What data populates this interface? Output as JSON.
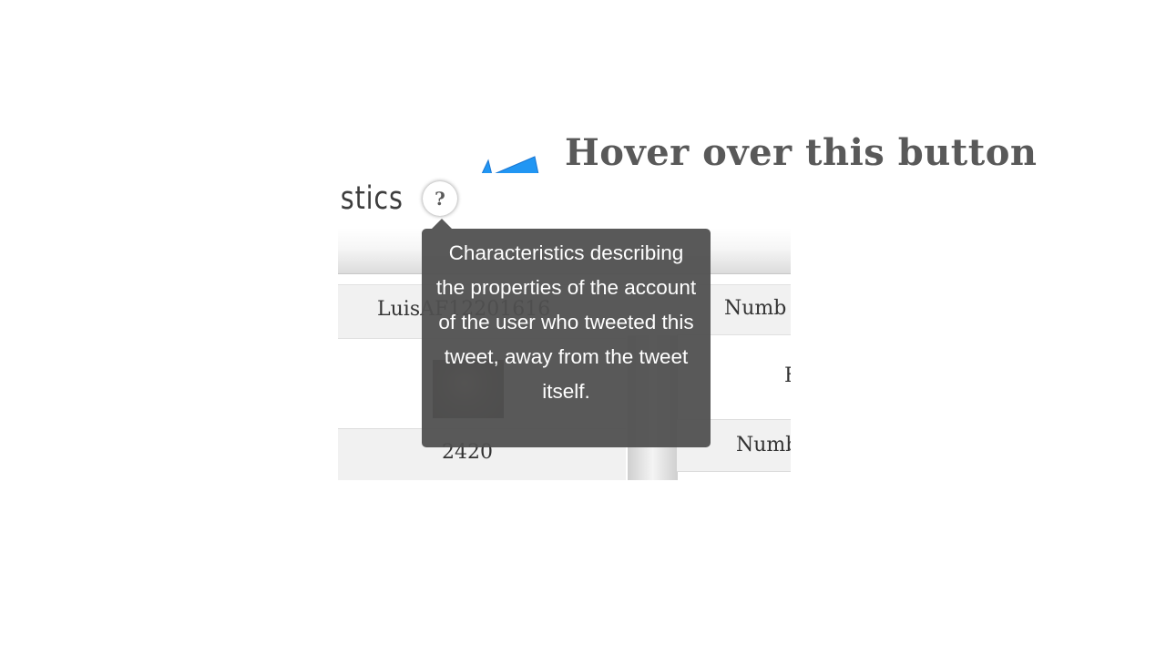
{
  "slide": {
    "headline": "Hover over this button",
    "arrow_icon": "arrow-left-icon",
    "arrow_color": "#2196F3",
    "headline_color": "#595959"
  },
  "panel": {
    "section_title": "istics",
    "help_button_label": "?",
    "username": "LuisAF12201616",
    "count": "2420",
    "label_number_1": "Numb",
    "label_fragment": "F",
    "label_number_2": "Numb"
  },
  "tooltip": {
    "text": "Characteristics describing the properties of the account of the user who tweeted this tweet, away from the tweet itself.",
    "background": "#505050"
  }
}
